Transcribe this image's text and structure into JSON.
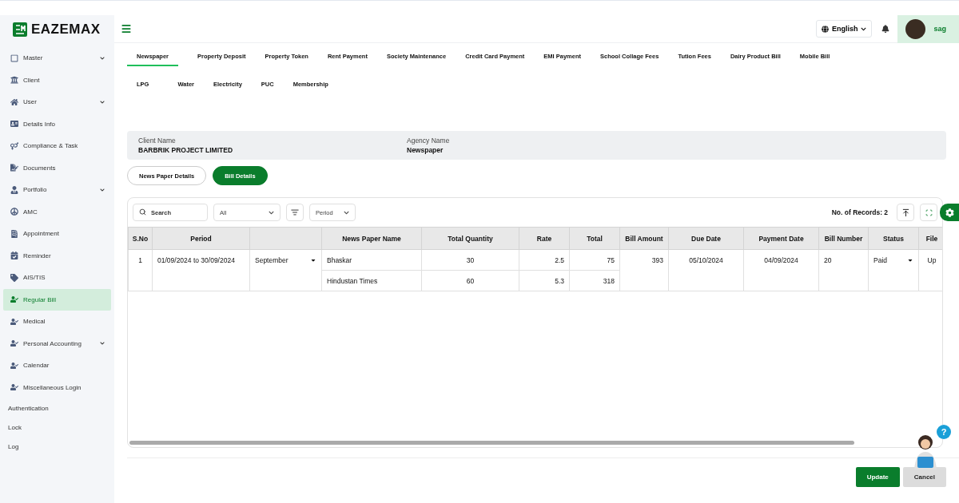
{
  "brand": {
    "name": "EAZEMAX"
  },
  "header": {
    "language": "English",
    "user": {
      "name": "sag"
    }
  },
  "sidebar": {
    "items": [
      {
        "label": "Master",
        "kind": "icon",
        "expandable": true,
        "selected": false
      },
      {
        "label": "Client",
        "kind": "icon",
        "expandable": false,
        "selected": false
      },
      {
        "label": "User",
        "kind": "icon",
        "expandable": true,
        "selected": false
      },
      {
        "label": "Details Info",
        "kind": "icon",
        "expandable": false,
        "selected": false
      },
      {
        "label": "Compliance & Task",
        "kind": "icon",
        "expandable": false,
        "selected": false
      },
      {
        "label": "Documents",
        "kind": "icon",
        "expandable": false,
        "selected": false
      },
      {
        "label": "Portfolio",
        "kind": "icon",
        "expandable": true,
        "selected": false
      },
      {
        "label": "AMC",
        "kind": "icon",
        "expandable": false,
        "selected": false
      },
      {
        "label": "Appointment",
        "kind": "icon",
        "expandable": false,
        "selected": false
      },
      {
        "label": "Reminder",
        "kind": "icon",
        "expandable": false,
        "selected": false
      },
      {
        "label": "AIS/TIS",
        "kind": "icon",
        "expandable": false,
        "selected": false
      },
      {
        "label": "Regular Bill",
        "kind": "icon",
        "expandable": false,
        "selected": true
      },
      {
        "label": "Medical",
        "kind": "icon",
        "expandable": false,
        "selected": false
      },
      {
        "label": "Personal Accounting",
        "kind": "icon",
        "expandable": true,
        "selected": false
      },
      {
        "label": "Calendar",
        "kind": "icon",
        "expandable": false,
        "selected": false
      },
      {
        "label": "Miscellaneous Login",
        "kind": "icon",
        "expandable": false,
        "selected": false
      },
      {
        "label": "Authentication",
        "kind": "text",
        "expandable": false,
        "selected": false
      },
      {
        "label": "Lock",
        "kind": "text",
        "expandable": false,
        "selected": false
      },
      {
        "label": "Log",
        "kind": "text",
        "expandable": false,
        "selected": false
      }
    ]
  },
  "tab_rows": [
    [
      {
        "label": "Newspaper",
        "selected": true
      },
      {
        "label": "Property Deposit",
        "selected": false
      },
      {
        "label": "Property Token",
        "selected": false
      },
      {
        "label": "Rent Payment",
        "selected": false
      },
      {
        "label": "Society Maintenance",
        "selected": false
      },
      {
        "label": "Credit Card Payment",
        "selected": false
      },
      {
        "label": "EMI Payment",
        "selected": false
      },
      {
        "label": "School Collage Fees",
        "selected": false
      },
      {
        "label": "Tution Fees",
        "selected": false
      },
      {
        "label": "Dairy Product Bill",
        "selected": false
      },
      {
        "label": "Mobile Bill",
        "selected": false
      }
    ],
    [
      {
        "label": "LPG",
        "selected": false
      },
      {
        "label": "Water",
        "selected": false
      },
      {
        "label": "Electricity",
        "selected": false
      },
      {
        "label": "PUC",
        "selected": false
      },
      {
        "label": "Membership",
        "selected": false
      }
    ]
  ],
  "info": [
    {
      "label": "Client Name",
      "value": "BARBRIK PROJECT LIMITED"
    },
    {
      "label": "Agency Name",
      "value": "Newspaper"
    }
  ],
  "sub_tabs": [
    {
      "label": "News Paper Details",
      "selected": false
    },
    {
      "label": "Bill Details",
      "selected": true
    }
  ],
  "toolbar": {
    "search": {
      "placeholder": "Search"
    },
    "filter": "All",
    "period": "Period",
    "records": "No. of Records: 2"
  },
  "table": {
    "columns": [
      "S.No",
      "Period",
      "News Paper Name",
      "Total Quantity",
      "Rate",
      "Total",
      "Bill Amount",
      "Due Date",
      "Payment Date",
      "Bill Number",
      "Status",
      "File"
    ],
    "rows": [
      {
        "sno": "1",
        "period": "01/09/2024 to 30/09/2024",
        "month": "September",
        "items": [
          {
            "name": "Bhaskar",
            "quantity": "30",
            "rate": "2.5",
            "total": "75"
          },
          {
            "name": "Hindustan Times",
            "quantity": "60",
            "rate": "5.3",
            "total": "318"
          }
        ],
        "bill_amount": "393",
        "due_date": "05/10/2024",
        "payment_date": "04/09/2024",
        "bill_number": "20",
        "status": "Paid",
        "file": "Up"
      }
    ]
  },
  "buttons": [
    {
      "label": "Update",
      "kind": "primary"
    },
    {
      "label": "Cancel",
      "kind": "secondary"
    }
  ],
  "help": {
    "badge": "?"
  }
}
